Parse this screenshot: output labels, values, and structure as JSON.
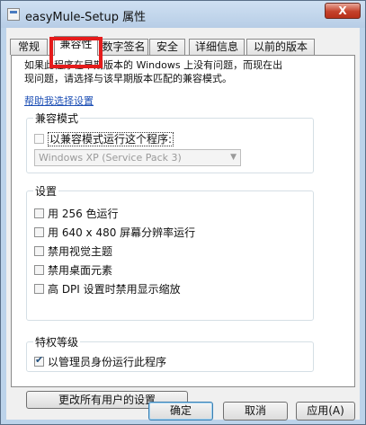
{
  "window": {
    "title": "easyMule-Setup 属性",
    "close_label": "X"
  },
  "tabs": [
    {
      "label": "常规",
      "active": false
    },
    {
      "label": "兼容性",
      "active": true
    },
    {
      "label": "数字签名",
      "active": false
    },
    {
      "label": "安全",
      "active": false
    },
    {
      "label": "详细信息",
      "active": false
    },
    {
      "label": "以前的版本",
      "active": false
    }
  ],
  "intro": {
    "line1": "如果此程序在早期版本的 Windows 上没有问题，而现在出",
    "line2": "现问题，请选择与该早期版本匹配的兼容模式。"
  },
  "help_link": "帮助我选择设置",
  "compat_mode": {
    "title": "兼容模式",
    "checkbox_label": "以兼容模式运行这个程序:",
    "checked": false,
    "select_value": "Windows XP (Service Pack 3)"
  },
  "settings": {
    "title": "设置",
    "items": [
      {
        "label": "用 256 色运行",
        "checked": false
      },
      {
        "label": "用 640 x 480 屏幕分辨率运行",
        "checked": false
      },
      {
        "label": "禁用视觉主题",
        "checked": false
      },
      {
        "label": "禁用桌面元素",
        "checked": false
      },
      {
        "label": "高 DPI 设置时禁用显示缩放",
        "checked": false
      }
    ]
  },
  "privilege": {
    "title": "特权等级",
    "checkbox_label": "以管理员身份运行此程序",
    "checked": true
  },
  "change_all_button": "更改所有用户的设置",
  "buttons": {
    "ok": "确定",
    "cancel": "取消",
    "apply": "应用(A)"
  },
  "highlight_color": "#e51b1b"
}
